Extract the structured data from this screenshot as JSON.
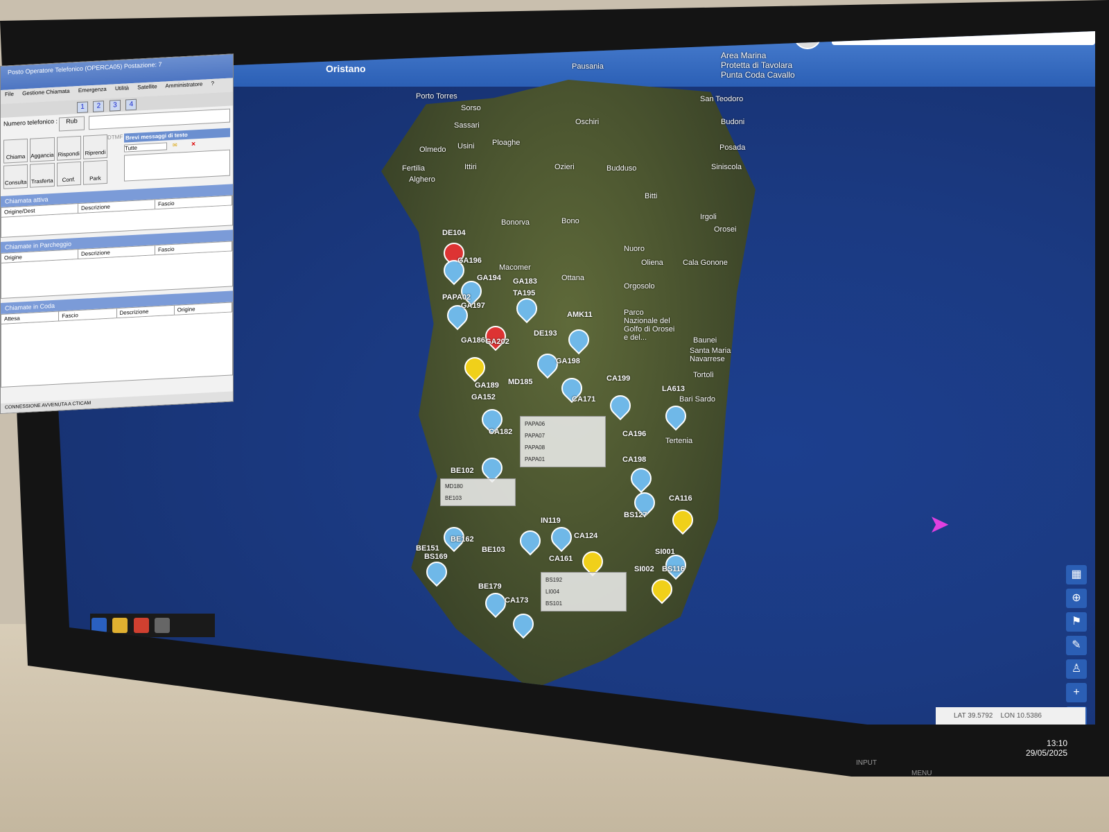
{
  "map": {
    "title": "Oristano",
    "search_icon": "search-icon",
    "places": [
      {
        "name": "Area Marina Protetta di Tavolara Punta Coda Cavallo"
      },
      {
        "name": "Pausania"
      },
      {
        "name": "Porto Torres"
      },
      {
        "name": "Sorso"
      },
      {
        "name": "Sassari"
      },
      {
        "name": "Oschiri"
      },
      {
        "name": "San Teodoro"
      },
      {
        "name": "Budoni"
      },
      {
        "name": "Posada"
      },
      {
        "name": "Siniscola"
      },
      {
        "name": "Olmedo"
      },
      {
        "name": "Usini"
      },
      {
        "name": "Ploaghe"
      },
      {
        "name": "Fertilia"
      },
      {
        "name": "Alghero"
      },
      {
        "name": "Ittiri"
      },
      {
        "name": "Ozieri"
      },
      {
        "name": "Budduso"
      },
      {
        "name": "Bitti"
      },
      {
        "name": "Bonorva"
      },
      {
        "name": "Bono"
      },
      {
        "name": "Irgoli"
      },
      {
        "name": "Orosei"
      },
      {
        "name": "Nuoro"
      },
      {
        "name": "Macomer"
      },
      {
        "name": "Oliena"
      },
      {
        "name": "Cala Gonone"
      },
      {
        "name": "Ottana"
      },
      {
        "name": "Orgosolo"
      },
      {
        "name": "Parco Nazionale del Golfo di Orosei e del..."
      },
      {
        "name": "Baunei"
      },
      {
        "name": "Santa Maria Navarrese"
      },
      {
        "name": "Tortolì"
      },
      {
        "name": "Bari Sardo"
      },
      {
        "name": "Tertenia"
      }
    ],
    "markers": [
      {
        "label": "DE104"
      },
      {
        "label": "GA196"
      },
      {
        "label": "GA194"
      },
      {
        "label": "GA183"
      },
      {
        "label": "PAPA02"
      },
      {
        "label": "GA197"
      },
      {
        "label": "TA195"
      },
      {
        "label": "AMK11"
      },
      {
        "label": "GA186"
      },
      {
        "label": "GA202"
      },
      {
        "label": "DE193"
      },
      {
        "label": "GA198"
      },
      {
        "label": "GA189"
      },
      {
        "label": "MD185"
      },
      {
        "label": "GA152"
      },
      {
        "label": "CA199"
      },
      {
        "label": "LA613"
      },
      {
        "label": "CA171"
      },
      {
        "label": "CA182"
      },
      {
        "label": "CA196"
      },
      {
        "label": "BE102"
      },
      {
        "label": "CA198"
      },
      {
        "label": "CA116"
      },
      {
        "label": "BS127"
      },
      {
        "label": "BE162"
      },
      {
        "label": "BE103"
      },
      {
        "label": "BS169"
      },
      {
        "label": "CA161"
      },
      {
        "label": "SI001"
      },
      {
        "label": "BE151"
      },
      {
        "label": "BE179"
      },
      {
        "label": "CA173"
      },
      {
        "label": "BS116"
      },
      {
        "label": "SI002"
      },
      {
        "label": "IN119"
      },
      {
        "label": "CA124"
      }
    ],
    "popup1": [
      "PAPA06",
      "PAPA07",
      "PAPA08",
      "PAPA01"
    ],
    "popup2": [
      "MD180",
      "BE103"
    ],
    "popup3": [
      "BS192",
      "LI004",
      "BS101"
    ],
    "coords": {
      "lat_label": "LAT",
      "lat": "39.5792",
      "lon_label": "LON",
      "lon": "10.5386"
    }
  },
  "panel": {
    "title": "Posto Operatore Telefonico (OPERCA05) Postazione: 7",
    "menu": [
      "File",
      "Gestione Chiamata",
      "Emergenza",
      "Utilità",
      "Satellite",
      "Amministratore",
      "?"
    ],
    "line_buttons": [
      "1",
      "2",
      "3",
      "4"
    ],
    "phone_label": "Numero telefonico :",
    "rub_label": "Rub",
    "sms_label": "Brevi messaggi di testo",
    "sms_filter": "Tutte",
    "call_buttons": [
      "Chiama",
      "Aggancia",
      "Rispondi",
      "Riprendi",
      "Consulta",
      "Trasferta",
      "Conf.",
      "Park"
    ],
    "dtmf_label": "DTMF",
    "active_call_title": "Chiamata attiva",
    "active_call_cols": [
      "Origine/Dest",
      "Descrizione",
      "Fascio"
    ],
    "parked_title": "Chiamate in Parcheggio",
    "parked_cols": [
      "Origine",
      "Descrizione",
      "Fascio"
    ],
    "queue_title": "Chiamate in Coda",
    "queue_cols": [
      "Attesa",
      "Fascio",
      "Descrizione",
      "Origine"
    ],
    "status": "CONNESSIONE AVVENUTA A CTICAM"
  },
  "system": {
    "time": "13:10",
    "date": "29/05/2025",
    "input_label": "INPUT",
    "menu_label": "MENU"
  },
  "colors": {
    "sea": "#1b3a82",
    "accent": "#2b5fb5",
    "marker": "#6fb8e8"
  }
}
